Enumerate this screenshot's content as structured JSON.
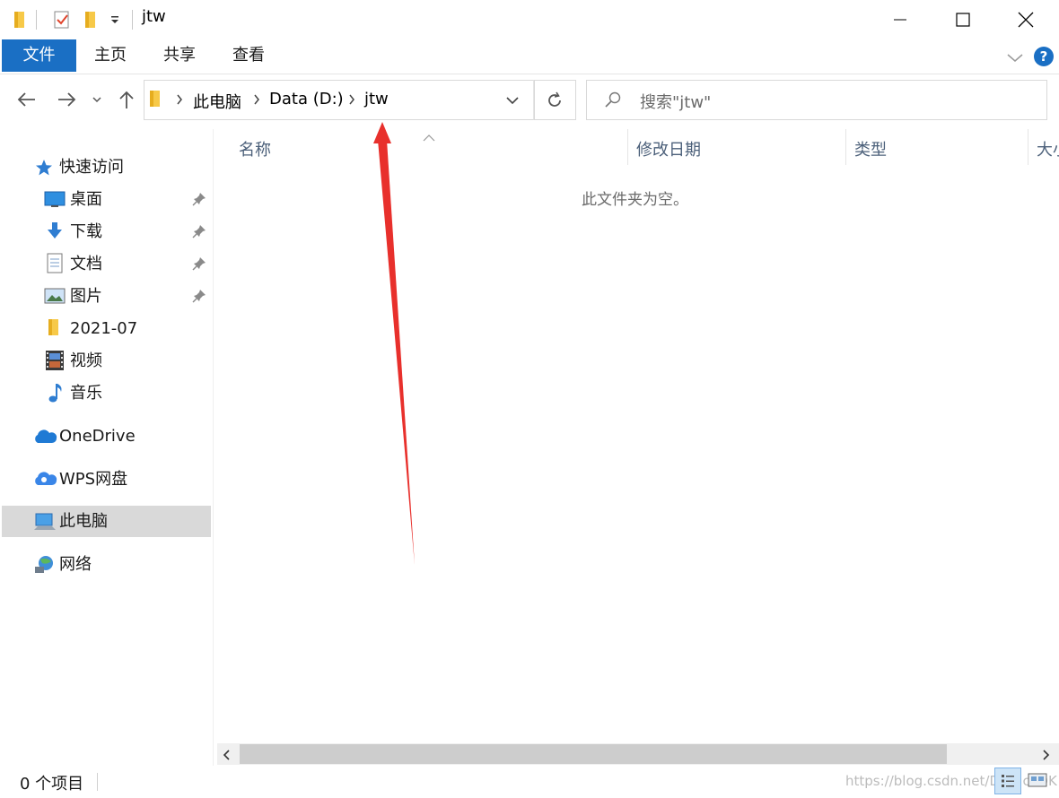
{
  "window": {
    "title": "jtw",
    "qat_dropdown_icon": "dropdown-caret-icon",
    "minimize_icon": "minimize-icon",
    "maximize_icon": "maximize-icon",
    "close_icon": "close-icon"
  },
  "ribbon": {
    "tabs": [
      {
        "label": "文件"
      },
      {
        "label": "主页"
      },
      {
        "label": "共享"
      },
      {
        "label": "查看"
      }
    ],
    "help_label": "?",
    "accent": "#1a6fc4"
  },
  "nav": {
    "breadcrumb": [
      {
        "label": "此电脑"
      },
      {
        "label": "Data (D:)"
      },
      {
        "label": "jtw"
      }
    ],
    "search_placeholder": "搜索\"jtw\""
  },
  "sidebar": {
    "quick_access": "快速访问",
    "items": [
      {
        "label": "桌面",
        "pinned": true
      },
      {
        "label": "下载",
        "pinned": true
      },
      {
        "label": "文档",
        "pinned": true
      },
      {
        "label": "图片",
        "pinned": true
      },
      {
        "label": "2021-07",
        "pinned": false
      },
      {
        "label": "视频",
        "pinned": false
      },
      {
        "label": "音乐",
        "pinned": false
      }
    ],
    "onedrive": "OneDrive",
    "wps": "WPS网盘",
    "this_pc": "此电脑",
    "network": "网络"
  },
  "content": {
    "columns": [
      "名称",
      "修改日期",
      "类型",
      "大小"
    ],
    "empty_message": "此文件夹为空。"
  },
  "status": {
    "item_count": "0 个项目",
    "watermark": "https://blog.csdn.net/DerrickDK"
  },
  "annotation_color": "#e8302c"
}
